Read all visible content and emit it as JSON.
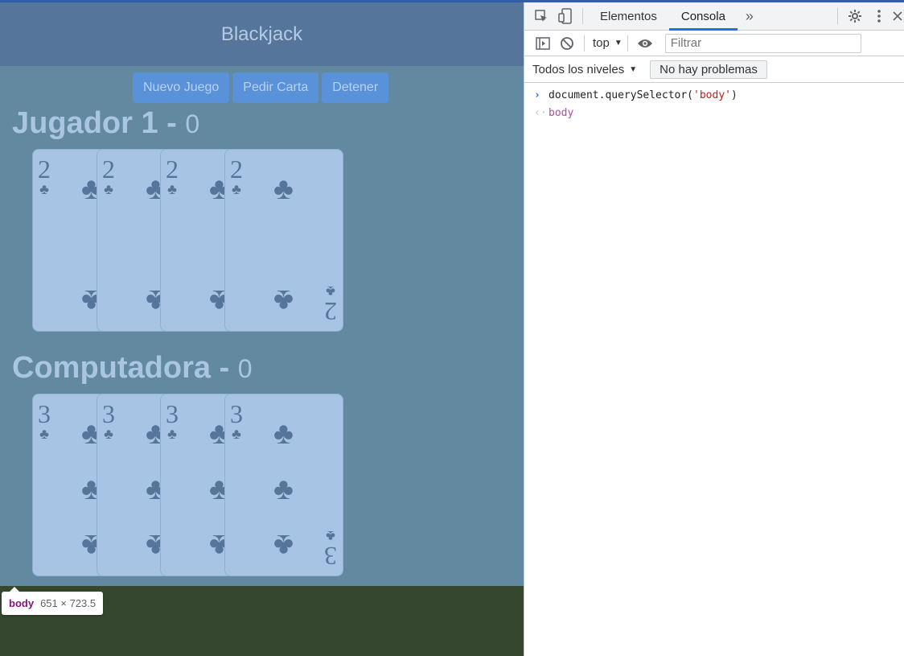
{
  "app": {
    "title": "Blackjack",
    "buttons": {
      "new_game": "Nuevo Juego",
      "hit": "Pedir Carta",
      "stop": "Detener"
    }
  },
  "players": [
    {
      "name": "Jugador 1 -",
      "score": "0",
      "cards": [
        {
          "rank": "2",
          "suit": "♣"
        },
        {
          "rank": "2",
          "suit": "♣"
        },
        {
          "rank": "2",
          "suit": "♣"
        },
        {
          "rank": "2",
          "suit": "♣"
        }
      ]
    },
    {
      "name": "Computadora -",
      "score": "0",
      "cards": [
        {
          "rank": "3",
          "suit": "♣"
        },
        {
          "rank": "3",
          "suit": "♣"
        },
        {
          "rank": "3",
          "suit": "♣"
        },
        {
          "rank": "3",
          "suit": "♣"
        }
      ]
    }
  ],
  "tooltip": {
    "tag": "body",
    "dims": "651 × 723.5"
  },
  "devtools": {
    "tabs": [
      "Elementos",
      "Consola"
    ],
    "active_tab": "Consola",
    "more_tabs_icon": "»",
    "context": "top",
    "filter_placeholder": "Filtrar",
    "levels": "Todos los niveles",
    "issues": "No hay problemas",
    "console": {
      "input_prefix": "document.querySelector(",
      "input_arg": "'body'",
      "input_suffix": ")",
      "result": "body"
    }
  },
  "colors": {
    "body_bg": "#6389a1",
    "header_bg": "#56759a",
    "card_bg": "#a7c4e5",
    "button_bg": "#5a92d9",
    "page_bottom": "#35482f",
    "devtools_accent": "#1a73e8"
  }
}
